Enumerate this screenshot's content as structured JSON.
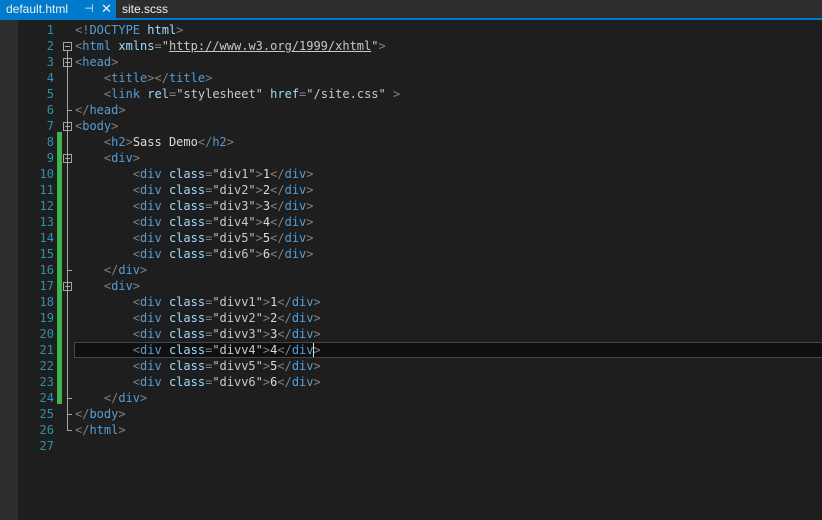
{
  "tabs": [
    {
      "label": "default.html",
      "active": true
    },
    {
      "label": "site.scss",
      "active": false
    }
  ],
  "tab_icons": {
    "pin": "pin-icon",
    "close": "close-icon"
  },
  "colors": {
    "accent": "#007acc",
    "change_bar": "#3cb54a",
    "line_number": "#2b91af",
    "tag": "#569cd6",
    "attr": "#9cdcfe"
  },
  "editor": {
    "current_line": 21,
    "lines": [
      {
        "n": "1",
        "tokens": [
          [
            "d",
            "<!"
          ],
          [
            "t",
            "DOCTYPE"
          ],
          [
            "x",
            " "
          ],
          [
            "a",
            "html"
          ],
          [
            "d",
            ">"
          ]
        ]
      },
      {
        "n": "2",
        "fold": "start",
        "tokens": [
          [
            "d",
            "<"
          ],
          [
            "t",
            "html"
          ],
          [
            "x",
            " "
          ],
          [
            "a",
            "xmlns"
          ],
          [
            "d",
            "="
          ],
          [
            "s",
            "\""
          ],
          [
            "l",
            "http://www.w3.org/1999/xhtml"
          ],
          [
            "s",
            "\""
          ],
          [
            "d",
            ">"
          ]
        ]
      },
      {
        "n": "3",
        "fold": "start",
        "tokens": [
          [
            "d",
            "<"
          ],
          [
            "t",
            "head"
          ],
          [
            "d",
            ">"
          ]
        ]
      },
      {
        "n": "4",
        "tokens": [
          [
            "x",
            "    "
          ],
          [
            "d",
            "<"
          ],
          [
            "t",
            "title"
          ],
          [
            "d",
            "></"
          ],
          [
            "t",
            "title"
          ],
          [
            "d",
            ">"
          ]
        ]
      },
      {
        "n": "5",
        "tokens": [
          [
            "x",
            "    "
          ],
          [
            "d",
            "<"
          ],
          [
            "t",
            "link"
          ],
          [
            "x",
            " "
          ],
          [
            "a",
            "rel"
          ],
          [
            "d",
            "="
          ],
          [
            "s",
            "\"stylesheet\""
          ],
          [
            "x",
            " "
          ],
          [
            "a",
            "href"
          ],
          [
            "d",
            "="
          ],
          [
            "s",
            "\"/site.css\""
          ],
          [
            "x",
            " "
          ],
          [
            "d",
            ">"
          ]
        ]
      },
      {
        "n": "6",
        "fold": "end",
        "tokens": [
          [
            "d",
            "</"
          ],
          [
            "t",
            "head"
          ],
          [
            "d",
            ">"
          ]
        ]
      },
      {
        "n": "7",
        "fold": "start",
        "tokens": [
          [
            "d",
            "<"
          ],
          [
            "t",
            "body"
          ],
          [
            "d",
            ">"
          ]
        ]
      },
      {
        "n": "8",
        "tokens": [
          [
            "x",
            "    "
          ],
          [
            "d",
            "<"
          ],
          [
            "t",
            "h2"
          ],
          [
            "d",
            ">"
          ],
          [
            "x",
            "Sass Demo"
          ],
          [
            "d",
            "</"
          ],
          [
            "t",
            "h2"
          ],
          [
            "d",
            ">"
          ]
        ]
      },
      {
        "n": "9",
        "fold": "start",
        "tokens": [
          [
            "x",
            "    "
          ],
          [
            "d",
            "<"
          ],
          [
            "t",
            "div"
          ],
          [
            "d",
            ">"
          ]
        ]
      },
      {
        "n": "10",
        "tokens": [
          [
            "x",
            "        "
          ],
          [
            "d",
            "<"
          ],
          [
            "t",
            "div"
          ],
          [
            "x",
            " "
          ],
          [
            "a",
            "class"
          ],
          [
            "d",
            "="
          ],
          [
            "s",
            "\"div1\""
          ],
          [
            "d",
            ">"
          ],
          [
            "x",
            "1"
          ],
          [
            "d",
            "</"
          ],
          [
            "t",
            "div"
          ],
          [
            "d",
            ">"
          ]
        ]
      },
      {
        "n": "11",
        "tokens": [
          [
            "x",
            "        "
          ],
          [
            "d",
            "<"
          ],
          [
            "t",
            "div"
          ],
          [
            "x",
            " "
          ],
          [
            "a",
            "class"
          ],
          [
            "d",
            "="
          ],
          [
            "s",
            "\"div2\""
          ],
          [
            "d",
            ">"
          ],
          [
            "x",
            "2"
          ],
          [
            "d",
            "</"
          ],
          [
            "t",
            "div"
          ],
          [
            "d",
            ">"
          ]
        ]
      },
      {
        "n": "12",
        "tokens": [
          [
            "x",
            "        "
          ],
          [
            "d",
            "<"
          ],
          [
            "t",
            "div"
          ],
          [
            "x",
            " "
          ],
          [
            "a",
            "class"
          ],
          [
            "d",
            "="
          ],
          [
            "s",
            "\"div3\""
          ],
          [
            "d",
            ">"
          ],
          [
            "x",
            "3"
          ],
          [
            "d",
            "</"
          ],
          [
            "t",
            "div"
          ],
          [
            "d",
            ">"
          ]
        ]
      },
      {
        "n": "13",
        "tokens": [
          [
            "x",
            "        "
          ],
          [
            "d",
            "<"
          ],
          [
            "t",
            "div"
          ],
          [
            "x",
            " "
          ],
          [
            "a",
            "class"
          ],
          [
            "d",
            "="
          ],
          [
            "s",
            "\"div4\""
          ],
          [
            "d",
            ">"
          ],
          [
            "x",
            "4"
          ],
          [
            "d",
            "</"
          ],
          [
            "t",
            "div"
          ],
          [
            "d",
            ">"
          ]
        ]
      },
      {
        "n": "14",
        "tokens": [
          [
            "x",
            "        "
          ],
          [
            "d",
            "<"
          ],
          [
            "t",
            "div"
          ],
          [
            "x",
            " "
          ],
          [
            "a",
            "class"
          ],
          [
            "d",
            "="
          ],
          [
            "s",
            "\"div5\""
          ],
          [
            "d",
            ">"
          ],
          [
            "x",
            "5"
          ],
          [
            "d",
            "</"
          ],
          [
            "t",
            "div"
          ],
          [
            "d",
            ">"
          ]
        ]
      },
      {
        "n": "15",
        "tokens": [
          [
            "x",
            "        "
          ],
          [
            "d",
            "<"
          ],
          [
            "t",
            "div"
          ],
          [
            "x",
            " "
          ],
          [
            "a",
            "class"
          ],
          [
            "d",
            "="
          ],
          [
            "s",
            "\"div6\""
          ],
          [
            "d",
            ">"
          ],
          [
            "x",
            "6"
          ],
          [
            "d",
            "</"
          ],
          [
            "t",
            "div"
          ],
          [
            "d",
            ">"
          ]
        ]
      },
      {
        "n": "16",
        "fold": "end",
        "tokens": [
          [
            "x",
            "    "
          ],
          [
            "d",
            "</"
          ],
          [
            "t",
            "div"
          ],
          [
            "d",
            ">"
          ]
        ]
      },
      {
        "n": "17",
        "fold": "start",
        "tokens": [
          [
            "x",
            "    "
          ],
          [
            "d",
            "<"
          ],
          [
            "t",
            "div"
          ],
          [
            "d",
            ">"
          ]
        ]
      },
      {
        "n": "18",
        "tokens": [
          [
            "x",
            "        "
          ],
          [
            "d",
            "<"
          ],
          [
            "t",
            "div"
          ],
          [
            "x",
            " "
          ],
          [
            "a",
            "class"
          ],
          [
            "d",
            "="
          ],
          [
            "s",
            "\"divv1\""
          ],
          [
            "d",
            ">"
          ],
          [
            "x",
            "1"
          ],
          [
            "d",
            "</"
          ],
          [
            "t",
            "div"
          ],
          [
            "d",
            ">"
          ]
        ]
      },
      {
        "n": "19",
        "tokens": [
          [
            "x",
            "        "
          ],
          [
            "d",
            "<"
          ],
          [
            "t",
            "div"
          ],
          [
            "x",
            " "
          ],
          [
            "a",
            "class"
          ],
          [
            "d",
            "="
          ],
          [
            "s",
            "\"divv2\""
          ],
          [
            "d",
            ">"
          ],
          [
            "x",
            "2"
          ],
          [
            "d",
            "</"
          ],
          [
            "t",
            "div"
          ],
          [
            "d",
            ">"
          ]
        ]
      },
      {
        "n": "20",
        "tokens": [
          [
            "x",
            "        "
          ],
          [
            "d",
            "<"
          ],
          [
            "t",
            "div"
          ],
          [
            "x",
            " "
          ],
          [
            "a",
            "class"
          ],
          [
            "d",
            "="
          ],
          [
            "s",
            "\"divv3\""
          ],
          [
            "d",
            ">"
          ],
          [
            "x",
            "3"
          ],
          [
            "d",
            "</"
          ],
          [
            "t",
            "div"
          ],
          [
            "d",
            ">"
          ]
        ]
      },
      {
        "n": "21",
        "tokens": [
          [
            "x",
            "        "
          ],
          [
            "d",
            "<"
          ],
          [
            "t",
            "div"
          ],
          [
            "x",
            " "
          ],
          [
            "a",
            "class"
          ],
          [
            "d",
            "="
          ],
          [
            "s",
            "\"divv4\""
          ],
          [
            "d",
            ">"
          ],
          [
            "x",
            "4"
          ],
          [
            "d",
            "</"
          ],
          [
            "t",
            "div"
          ],
          [
            "d",
            ">"
          ]
        ]
      },
      {
        "n": "22",
        "tokens": [
          [
            "x",
            "        "
          ],
          [
            "d",
            "<"
          ],
          [
            "t",
            "div"
          ],
          [
            "x",
            " "
          ],
          [
            "a",
            "class"
          ],
          [
            "d",
            "="
          ],
          [
            "s",
            "\"divv5\""
          ],
          [
            "d",
            ">"
          ],
          [
            "x",
            "5"
          ],
          [
            "d",
            "</"
          ],
          [
            "t",
            "div"
          ],
          [
            "d",
            ">"
          ]
        ]
      },
      {
        "n": "23",
        "tokens": [
          [
            "x",
            "        "
          ],
          [
            "d",
            "<"
          ],
          [
            "t",
            "div"
          ],
          [
            "x",
            " "
          ],
          [
            "a",
            "class"
          ],
          [
            "d",
            "="
          ],
          [
            "s",
            "\"divv6\""
          ],
          [
            "d",
            ">"
          ],
          [
            "x",
            "6"
          ],
          [
            "d",
            "</"
          ],
          [
            "t",
            "div"
          ],
          [
            "d",
            ">"
          ]
        ]
      },
      {
        "n": "24",
        "fold": "end",
        "tokens": [
          [
            "x",
            "    "
          ],
          [
            "d",
            "</"
          ],
          [
            "t",
            "div"
          ],
          [
            "d",
            ">"
          ]
        ]
      },
      {
        "n": "25",
        "fold": "end",
        "tokens": [
          [
            "d",
            "</"
          ],
          [
            "t",
            "body"
          ],
          [
            "d",
            ">"
          ]
        ]
      },
      {
        "n": "26",
        "fold": "end",
        "tokens": [
          [
            "d",
            "</"
          ],
          [
            "t",
            "html"
          ],
          [
            "d",
            ">"
          ]
        ]
      },
      {
        "n": "27",
        "tokens": []
      }
    ]
  }
}
